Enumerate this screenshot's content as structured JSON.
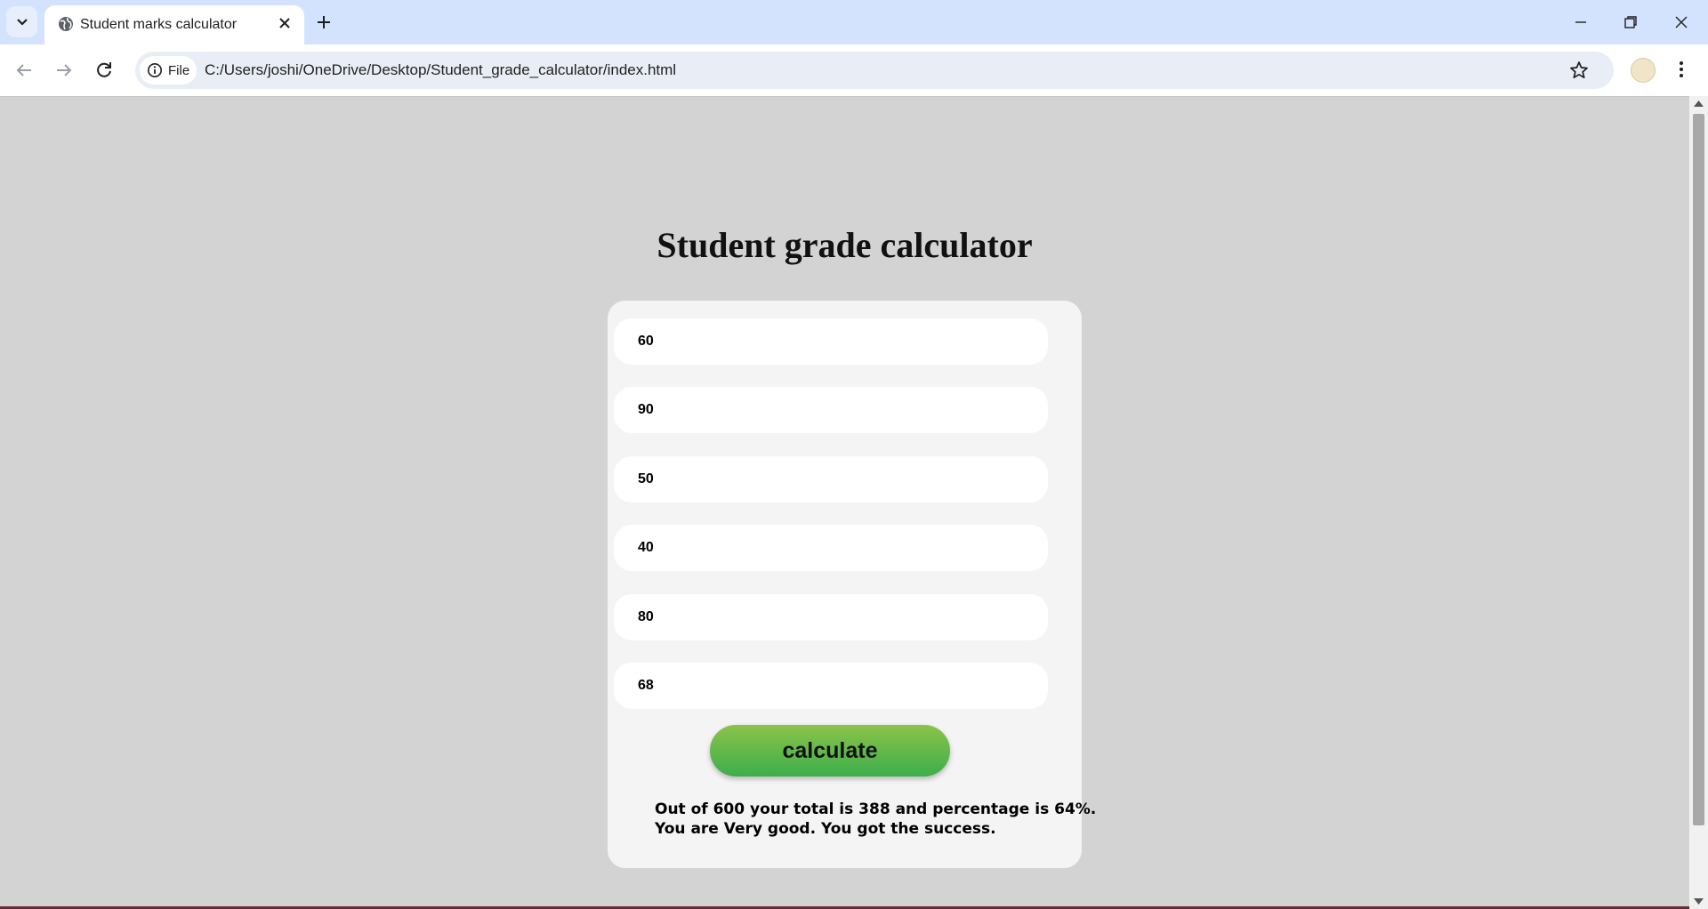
{
  "browser": {
    "tab_title": "Student marks calculator",
    "scheme_chip": "File",
    "url": "C:/Users/joshi/OneDrive/Desktop/Student_grade_calculator/index.html"
  },
  "page": {
    "title": "Student grade calculator",
    "marks": [
      "60",
      "90",
      "50",
      "40",
      "80",
      "68"
    ],
    "button_label": "calculate",
    "result_line1": "Out of 600 your total is 388 and percentage is 64%.",
    "result_line2": "You are Very good. You got the success."
  },
  "colors": {
    "page_background": "#d3d3d3",
    "card_background": "#f4f4f4",
    "button_gradient_top": "#8bc34a",
    "button_gradient_bottom": "#3dae4b",
    "tabstrip": "#d3e3fd"
  },
  "icons": [
    "tab-search-icon",
    "globe-icon",
    "close-icon",
    "plus-icon",
    "minimize-icon",
    "restore-icon",
    "back-icon",
    "forward-icon",
    "reload-icon",
    "info-icon",
    "star-icon",
    "avatar",
    "more-vert-icon"
  ]
}
